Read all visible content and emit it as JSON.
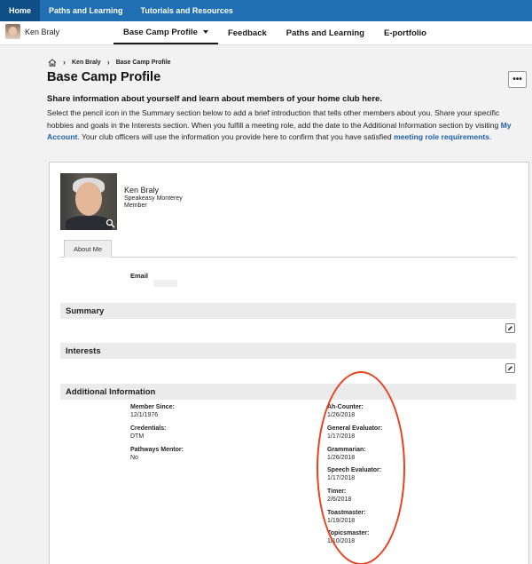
{
  "topbar": {
    "tabs": [
      "Home",
      "Paths and Learning",
      "Tutorials and Resources"
    ]
  },
  "user": {
    "name": "Ken Braly"
  },
  "nav": {
    "items": [
      "Base Camp Profile",
      "Feedback",
      "Paths and Learning",
      "E-portfolio"
    ]
  },
  "breadcrumb": {
    "items": [
      "Ken Braly",
      "Base Camp Profile"
    ]
  },
  "page": {
    "title": "Base Camp Profile",
    "more_label": "•••"
  },
  "intro": {
    "heading": "Share information about yourself and learn about members of your home club here.",
    "text_1": "Select the pencil icon in the Summary section below to add a brief introduction that tells other members about you. Share your specific hobbies and goals in the Interests section. When you fulfill a meeting role, add the date to the Additional Information section by visiting ",
    "link_account": "My Account",
    "text_2": ". Your club officers will use the information you provide here to confirm that you have satisfied ",
    "link_requirements": "meeting role requirements",
    "text_3": "."
  },
  "profile": {
    "name": "Ken Braly",
    "club": "Speakeasy Monterey",
    "role": "Member"
  },
  "tabs": {
    "about_label": "About Me"
  },
  "email": {
    "label": "Email"
  },
  "sections": {
    "summary": "Summary",
    "interests": "Interests",
    "additional": "Additional Information"
  },
  "additional_info": {
    "left": [
      {
        "label": "Member Since:",
        "value": "12/1/1976"
      },
      {
        "label": "Credentials:",
        "value": "DTM"
      },
      {
        "label": "Pathways Mentor:",
        "value": "No"
      }
    ],
    "right": [
      {
        "label": "Ah-Counter:",
        "value": "1/26/2018"
      },
      {
        "label": "General Evaluator:",
        "value": "1/17/2018"
      },
      {
        "label": "Grammarian:",
        "value": "1/26/2018"
      },
      {
        "label": "Speech Evaluator:",
        "value": "1/17/2018"
      },
      {
        "label": "Timer:",
        "value": "2/6/2018"
      },
      {
        "label": "Toastmaster:",
        "value": "1/19/2018"
      },
      {
        "label": "Topicsmaster:",
        "value": "1/10/2018"
      }
    ]
  },
  "colors": {
    "topbar": "#1f6fb2",
    "topbar_active": "#0f4f86",
    "link": "#1f5fa8",
    "annotation_oval": "#e8401c"
  }
}
